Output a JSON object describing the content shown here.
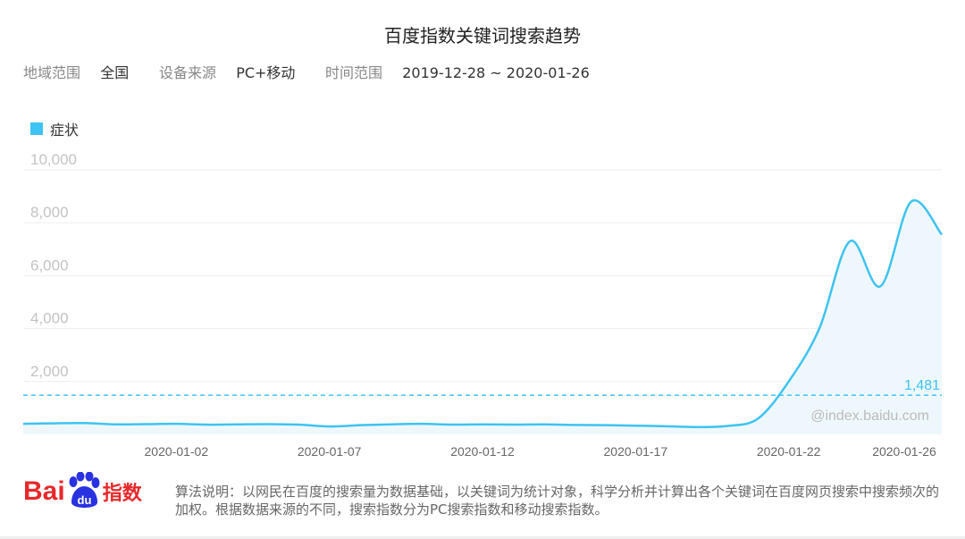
{
  "title": "百度指数关键词搜索趋势",
  "meta": {
    "region_label": "地域范围",
    "region_value": "全国",
    "device_label": "设备来源",
    "device_value": "PC+移动",
    "time_label": "时间范围",
    "time_value": "2019-12-28 ~ 2020-01-26"
  },
  "colors": {
    "series": "#3ec3f2",
    "fill": "#eef8fc",
    "grid": "#eeeeee",
    "axis_text": "#999999",
    "brand_red": "#e8282b",
    "brand_blue": "#2932e1"
  },
  "watermark": "@index.baidu.com",
  "logo": {
    "part1": "Bai",
    "paw_text": "du",
    "part2": "指数"
  },
  "note": "算法说明：以网民在百度的搜索量为数据基础，以关键词为统计对象，科学分析并计算出各个关键词在百度网页搜索中搜索频次的加权。根据数据来源的不同，搜索指数分为PC搜索指数和移动搜索指数。",
  "chart_data": {
    "type": "area",
    "title": "",
    "x": [
      "2019-12-28",
      "2019-12-29",
      "2019-12-30",
      "2019-12-31",
      "2020-01-01",
      "2020-01-02",
      "2020-01-03",
      "2020-01-04",
      "2020-01-05",
      "2020-01-06",
      "2020-01-07",
      "2020-01-08",
      "2020-01-09",
      "2020-01-10",
      "2020-01-11",
      "2020-01-12",
      "2020-01-13",
      "2020-01-14",
      "2020-01-15",
      "2020-01-16",
      "2020-01-17",
      "2020-01-18",
      "2020-01-19",
      "2020-01-20",
      "2020-01-21",
      "2020-01-22",
      "2020-01-23",
      "2020-01-24",
      "2020-01-25",
      "2020-01-26"
    ],
    "x_tick_labels": [
      {
        "index": 5,
        "label": "2020-01-02"
      },
      {
        "index": 10,
        "label": "2020-01-07"
      },
      {
        "index": 15,
        "label": "2020-01-12"
      },
      {
        "index": 20,
        "label": "2020-01-17"
      },
      {
        "index": 25,
        "label": "2020-01-22"
      },
      {
        "index": 29,
        "label": "2020-01-26"
      }
    ],
    "ylim": [
      0,
      10000
    ],
    "y_ticks": [
      2000,
      4000,
      6000,
      8000,
      10000
    ],
    "y_tick_labels": [
      "2,000",
      "4,000",
      "6,000",
      "8,000",
      "10,000"
    ],
    "grid": true,
    "legend_position": "top-left",
    "series": [
      {
        "name": "症状",
        "values": [
          400,
          420,
          430,
          380,
          390,
          400,
          370,
          380,
          390,
          370,
          300,
          350,
          380,
          400,
          370,
          380,
          370,
          380,
          360,
          350,
          330,
          310,
          280,
          320,
          600,
          2000,
          4000,
          7300,
          5600,
          8800,
          7550
        ]
      }
    ],
    "average_line": {
      "value": 1481,
      "label": "1,481"
    }
  }
}
